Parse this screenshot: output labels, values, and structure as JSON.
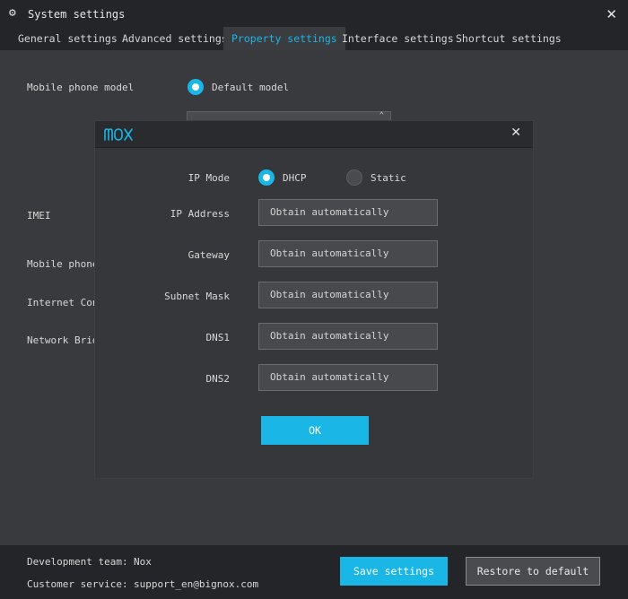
{
  "window": {
    "title": "System settings"
  },
  "tabs": [
    {
      "label": "General settings"
    },
    {
      "label": "Advanced settings"
    },
    {
      "label": "Property settings"
    },
    {
      "label": "Interface settings"
    },
    {
      "label": "Shortcut settings"
    }
  ],
  "active_tab": "Property settings",
  "property": {
    "mobile_phone_model_label": "Mobile phone model",
    "default_model_option": "Default model",
    "imei_label": "IMEI",
    "mobile_phone_label_partial": "Mobile phone",
    "internet_label_partial": "Internet Conn",
    "network_bridge_label_partial": "Network Brid"
  },
  "modal": {
    "logo_text": "nox",
    "ip_mode_label": "IP Mode",
    "ip_mode_options": [
      "DHCP",
      "Static"
    ],
    "ip_mode_selected": "DHCP",
    "fields": [
      {
        "label": "IP Address",
        "value": "Obtain automatically"
      },
      {
        "label": "Gateway",
        "value": "Obtain automatically"
      },
      {
        "label": "Subnet Mask",
        "value": "Obtain automatically"
      },
      {
        "label": "DNS1",
        "value": "Obtain automatically"
      },
      {
        "label": "DNS2",
        "value": "Obtain automatically"
      }
    ],
    "ok_label": "OK"
  },
  "footer": {
    "dev_team_label": "Development team:",
    "dev_team_value": "Nox",
    "customer_service_label": "Customer service:",
    "customer_service_value": "support_en@bignox.com",
    "save_label": "Save settings",
    "restore_label": "Restore to default"
  },
  "colors": {
    "accent": "#19b6e6",
    "background": "#242529",
    "panel": "#393a3e"
  }
}
